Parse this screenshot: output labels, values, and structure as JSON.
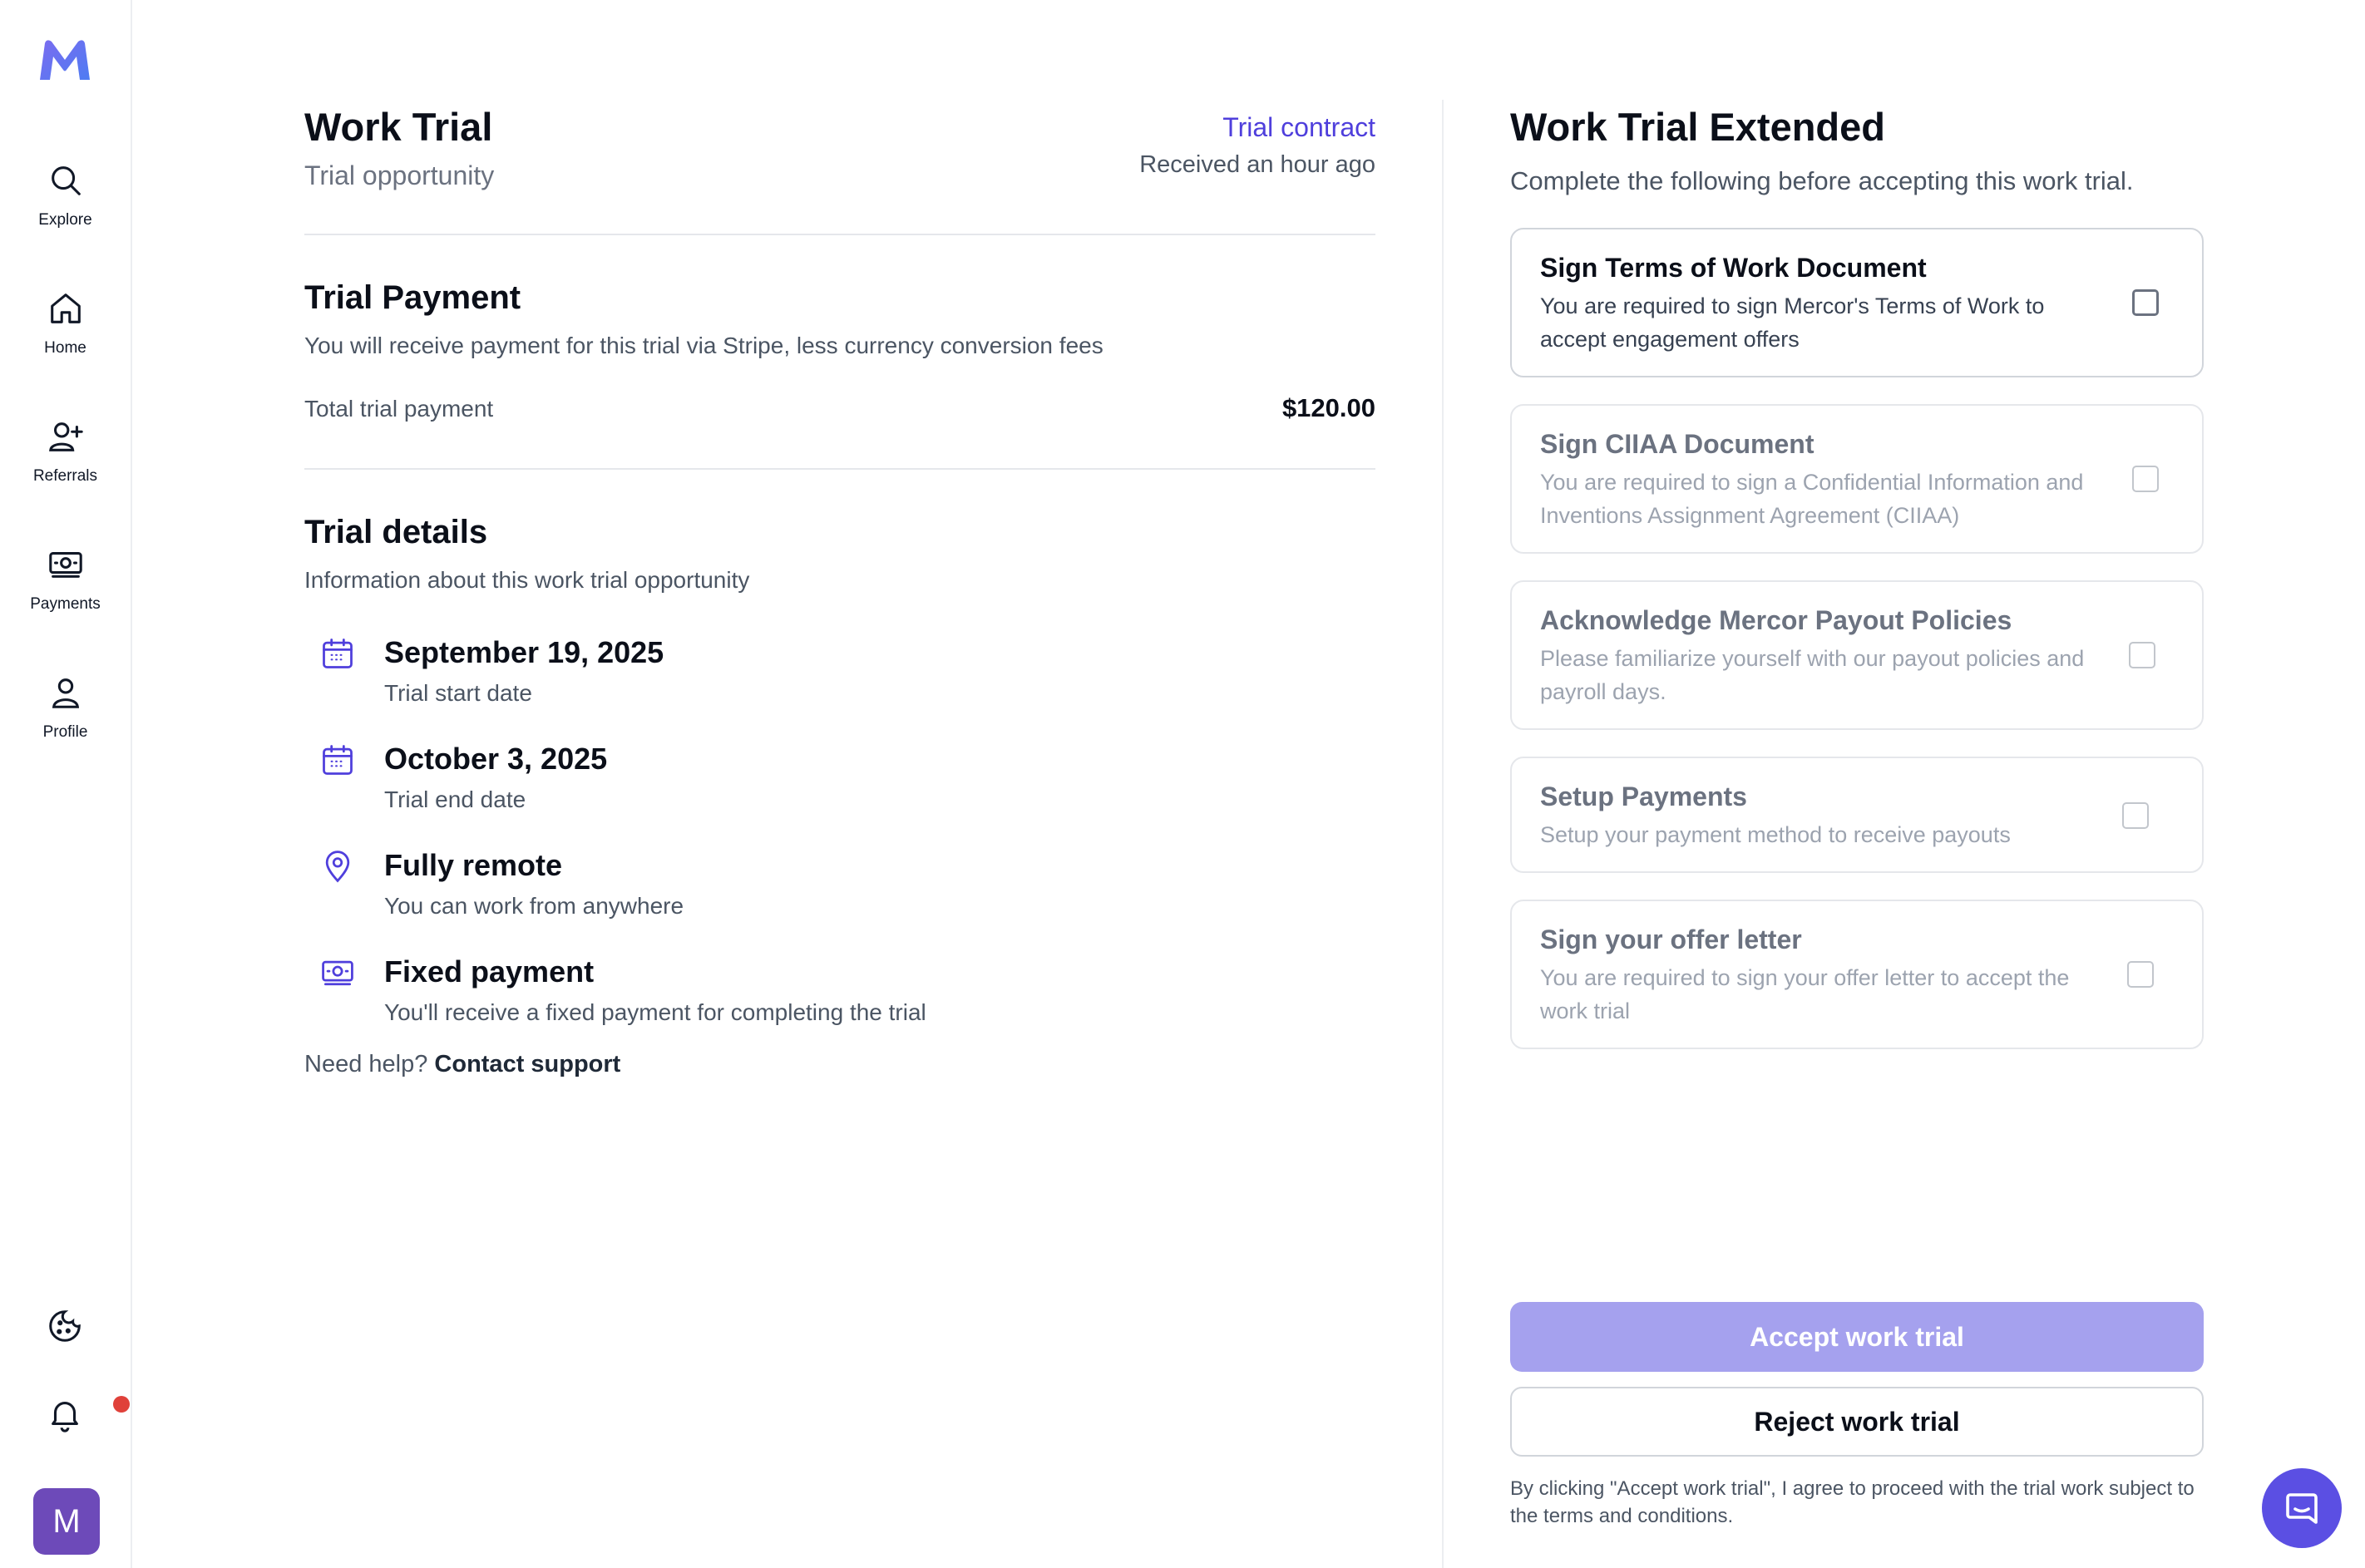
{
  "sidebar": {
    "logo_letter": "M",
    "items": [
      {
        "label": "Explore",
        "icon": "search-icon"
      },
      {
        "label": "Home",
        "icon": "home-icon"
      },
      {
        "label": "Referrals",
        "icon": "user-plus-icon"
      },
      {
        "label": "Payments",
        "icon": "money-icon"
      },
      {
        "label": "Profile",
        "icon": "user-icon"
      }
    ],
    "avatar_initial": "M"
  },
  "header": {
    "title": "Work Trial",
    "subtitle": "Trial opportunity",
    "contract_link": "Trial contract",
    "received": "Received an hour ago"
  },
  "payment": {
    "title": "Trial Payment",
    "description": "You will receive payment for this trial via Stripe, less currency conversion fees",
    "total_label": "Total trial payment",
    "total_value": "$120.00"
  },
  "details": {
    "title": "Trial details",
    "description": "Information about this work trial opportunity",
    "items": [
      {
        "icon": "calendar-icon",
        "title": "September 19, 2025",
        "subtitle": "Trial start date"
      },
      {
        "icon": "calendar-icon",
        "title": "October 3, 2025",
        "subtitle": "Trial end date"
      },
      {
        "icon": "location-pin-icon",
        "title": "Fully remote",
        "subtitle": "You can work from anywhere"
      },
      {
        "icon": "money-icon",
        "title": "Fixed payment",
        "subtitle": "You'll receive a fixed payment for completing the trial"
      }
    ],
    "help_text": "Need help?",
    "help_link": "Contact support"
  },
  "checklist": {
    "title": "Work Trial Extended",
    "subtitle": "Complete the following before accepting this work trial.",
    "items": [
      {
        "title": "Sign Terms of Work Document",
        "description": "You are required to sign Mercor's Terms of Work to accept engagement offers",
        "checked": false,
        "enabled": true
      },
      {
        "title": "Sign CIIAA Document",
        "description": "You are required to sign a Confidential Information and Inventions Assignment Agreement (CIIAA)",
        "checked": false,
        "enabled": false
      },
      {
        "title": "Acknowledge Mercor Payout Policies",
        "description": "Please familiarize yourself with our payout policies and payroll days.",
        "checked": false,
        "enabled": false
      },
      {
        "title": "Setup Payments",
        "description": "Setup your payment method to receive payouts",
        "checked": false,
        "enabled": false
      },
      {
        "title": "Sign your offer letter",
        "description": "You are required to sign your offer letter to accept the work trial",
        "checked": false,
        "enabled": false
      }
    ]
  },
  "actions": {
    "accept_label": "Accept work trial",
    "reject_label": "Reject work trial",
    "disclaimer": "By clicking \"Accept work trial\", I agree to proceed with the trial work subject to the terms and conditions."
  },
  "colors": {
    "accent": "#4f3fdc",
    "accept_button": "#a5a1ee",
    "notification_dot": "#e0413a",
    "avatar": "#6d4ab9",
    "chat_button": "#5b4fe3"
  }
}
